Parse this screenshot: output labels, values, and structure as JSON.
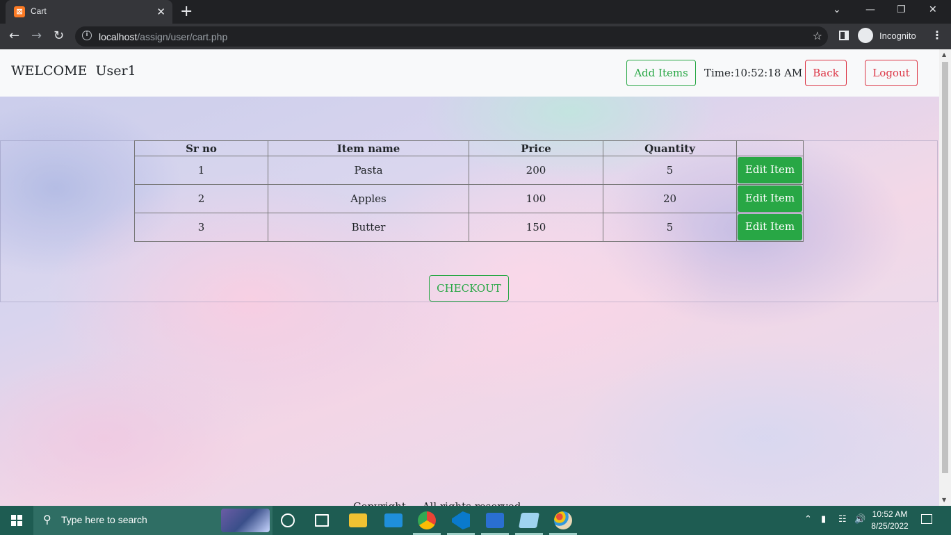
{
  "browser": {
    "tab_title": "Cart",
    "tab_favicon": "xampp-icon",
    "url_host": "localhost",
    "url_path": "/assign/user/cart.php",
    "profile_label": "Incognito"
  },
  "navbar": {
    "welcome": "WELCOME  User1",
    "add_items": "Add Items",
    "time": "Time:10:52:18 AM",
    "back": "Back",
    "logout": "Logout"
  },
  "cart": {
    "headers": [
      "Sr no",
      "Item name",
      "Price",
      "Quantity",
      ""
    ],
    "rows": [
      {
        "sr": "1",
        "name": "Pasta",
        "price": "200",
        "qty": "5",
        "action": "Edit Item"
      },
      {
        "sr": "2",
        "name": "Apples",
        "price": "100",
        "qty": "20",
        "action": "Edit Item"
      },
      {
        "sr": "3",
        "name": "Butter",
        "price": "150",
        "qty": "5",
        "action": "Edit Item"
      }
    ],
    "checkout": "CHECKOUT"
  },
  "footer": {
    "text": "Copyright ... All rights reserved"
  },
  "taskbar": {
    "search_placeholder": "Type here to search",
    "clock_time": "10:52 AM",
    "clock_date": "8/25/2022",
    "apps": [
      "cortana-icon",
      "task-view-icon",
      "file-explorer-icon",
      "remote-desktop-icon",
      "chrome-icon",
      "vscode-icon",
      "powershell-icon",
      "notepad-icon",
      "paint-icon"
    ]
  },
  "colors": {
    "success": "#28a745",
    "danger": "#dc3545",
    "taskbar": "#1e5c52",
    "navbar_bg": "#f8f9fa"
  }
}
